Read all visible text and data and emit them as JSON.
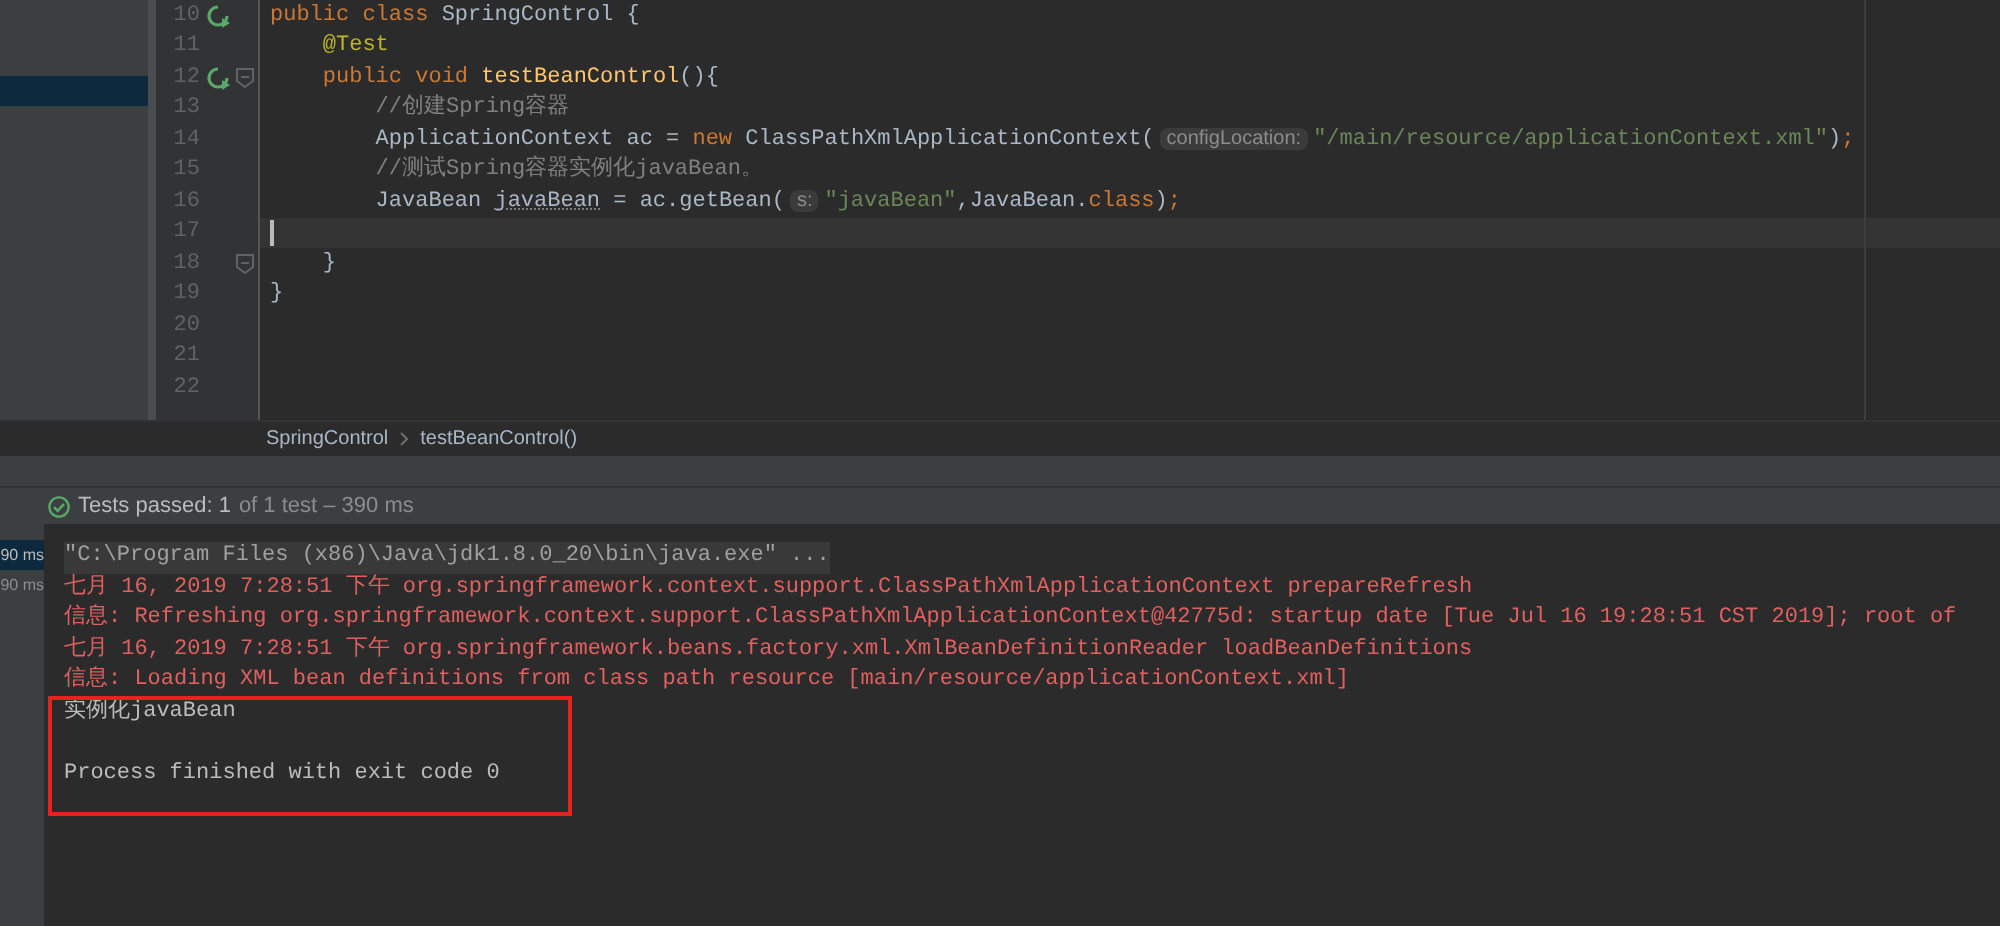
{
  "editor": {
    "lines": [
      {
        "number": "10",
        "run_icon": true,
        "fold": false,
        "current": false,
        "tokens": [
          {
            "kind": "keyword",
            "text": "public class "
          },
          {
            "kind": "plain",
            "text": "SpringControl {"
          }
        ]
      },
      {
        "number": "11",
        "run_icon": false,
        "fold": false,
        "current": false,
        "tokens": [
          {
            "kind": "annotation",
            "text": "    @Test"
          }
        ]
      },
      {
        "number": "12",
        "run_icon": true,
        "fold": true,
        "current": false,
        "tokens": [
          {
            "kind": "keyword",
            "text": "    public void "
          },
          {
            "kind": "method",
            "text": "testBeanControl"
          },
          {
            "kind": "plain",
            "text": "(){"
          }
        ]
      },
      {
        "number": "13",
        "run_icon": false,
        "fold": false,
        "current": false,
        "tokens": [
          {
            "kind": "comment",
            "text": "        //创建Spring容器"
          }
        ]
      },
      {
        "number": "14",
        "run_icon": false,
        "fold": false,
        "current": false,
        "tokens": [
          {
            "kind": "plain",
            "text": "        ApplicationContext ac = "
          },
          {
            "kind": "keyword",
            "text": "new "
          },
          {
            "kind": "plain",
            "text": "ClassPathXmlApplicationContext("
          },
          {
            "kind": "hint",
            "text": "configLocation:"
          },
          {
            "kind": "string",
            "text": "\"/main/resource/applicationContext.xml\""
          },
          {
            "kind": "plain",
            "text": ")"
          },
          {
            "kind": "keyword",
            "text": ";"
          }
        ]
      },
      {
        "number": "15",
        "run_icon": false,
        "fold": false,
        "current": false,
        "tokens": [
          {
            "kind": "comment",
            "text": "        //测试Spring容器实例化javaBean。"
          }
        ]
      },
      {
        "number": "16",
        "run_icon": false,
        "fold": false,
        "current": false,
        "tokens": [
          {
            "kind": "plain",
            "text": "        JavaBean "
          },
          {
            "kind": "warning",
            "text": "javaBean"
          },
          {
            "kind": "plain",
            "text": " = ac.getBean("
          },
          {
            "kind": "hint",
            "text": "s:"
          },
          {
            "kind": "string",
            "text": "\"javaBean\""
          },
          {
            "kind": "plain",
            "text": ",JavaBean."
          },
          {
            "kind": "keyword",
            "text": "class"
          },
          {
            "kind": "plain",
            "text": ")"
          },
          {
            "kind": "keyword",
            "text": ";"
          }
        ]
      },
      {
        "number": "17",
        "run_icon": false,
        "fold": false,
        "current": true
      },
      {
        "number": "18",
        "run_icon": false,
        "fold": true,
        "current": false,
        "tokens": [
          {
            "kind": "plain",
            "text": "    }"
          }
        ]
      },
      {
        "number": "19",
        "run_icon": false,
        "fold": false,
        "current": false,
        "tokens": [
          {
            "kind": "plain",
            "text": "}"
          }
        ]
      },
      {
        "number": "20",
        "run_icon": false,
        "fold": false,
        "current": false
      },
      {
        "number": "21",
        "run_icon": false,
        "fold": false,
        "current": false
      },
      {
        "number": "22",
        "run_icon": false,
        "fold": false,
        "current": false
      }
    ],
    "breadcrumbs": [
      "SpringControl",
      "testBeanControl()"
    ]
  },
  "run_panel": {
    "status": "Tests passed: 1",
    "detail": "of 1 test – 390 ms",
    "tests": [
      {
        "label": "90 ms",
        "selected": true
      },
      {
        "label": "90 ms",
        "selected": false
      }
    ],
    "console": [
      {
        "kind": "command",
        "text": "\"C:\\Program Files (x86)\\Java\\jdk1.8.0_20\\bin\\java.exe\" ..."
      },
      {
        "kind": "log",
        "text": "七月 16, 2019 7:28:51 下午 org.springframework.context.support.ClassPathXmlApplicationContext prepareRefresh"
      },
      {
        "kind": "log",
        "text": "信息: Refreshing org.springframework.context.support.ClassPathXmlApplicationContext@42775d: startup date [Tue Jul 16 19:28:51 CST 2019]; root of"
      },
      {
        "kind": "log",
        "text": "七月 16, 2019 7:28:51 下午 org.springframework.beans.factory.xml.XmlBeanDefinitionReader loadBeanDefinitions"
      },
      {
        "kind": "log",
        "text": "信息: Loading XML bean definitions from class path resource [main/resource/applicationContext.xml]"
      },
      {
        "kind": "output",
        "text": "实例化javaBean"
      },
      {
        "kind": "exit",
        "text": "Process finished with exit code 0"
      }
    ]
  }
}
